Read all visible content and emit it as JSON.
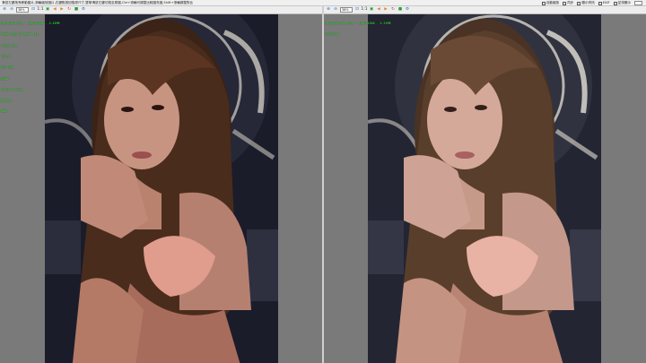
{
  "topbar": {
    "hint": "滑鼠左鍵拖曳移動圖片,滾輪縮放圖片,右鍵點按回復原尺寸,雙擊滑鼠左鍵切換至原圖,Ctrl+滾輪可調整比較圖亮度,Shift+滾輪調整對比",
    "options": [
      {
        "label": "自動縮放"
      },
      {
        "label": "同步"
      },
      {
        "label": "顯示資訊"
      },
      {
        "label": "EXIF"
      },
      {
        "label": "並排顯示"
      }
    ]
  },
  "left": {
    "zoom": "38%",
    "filename": "IMG_9487.JPG - 1067x1600 - 4.45MB",
    "info_lines": [
      "IMG_9487.JPG - 1067x1600 - 4.45MB",
      "Canon EOS 5D Mark III",
      "1/125 sec",
      "f/8.0",
      "ISO 100",
      "85mm",
      "Flash: Fired",
      "Manual",
      "AWB"
    ]
  },
  "right": {
    "zoom": "38%",
    "filename": "IMG_9487_HDR.JPG - 1067x1600 - 5.51MB",
    "info_lines": [
      "IMG_9487_HDR.JPG - 1067x1600 - 5.51MB",
      "ExifTool"
    ]
  },
  "colors": {
    "overlay_text": "#33ff33",
    "pane_bg": "#7a7a7a",
    "toolbar_bg": "#ededed"
  }
}
